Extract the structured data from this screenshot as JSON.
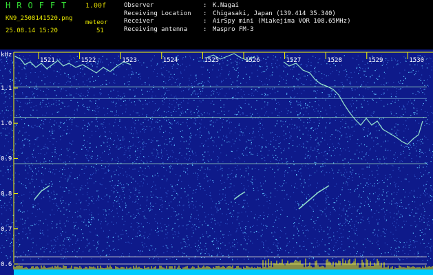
{
  "header": {
    "app_title": "HROFFT",
    "version": "1.00f",
    "file_name": "KN9_2508141520.png",
    "kind": "meteor",
    "datetime": "25.08.14 15:20",
    "count": "51",
    "info": [
      {
        "label": "Observer",
        "value": "K.Nagai"
      },
      {
        "label": "Receiving Location",
        "value": "Chigasaki, Japan (139.414 35.340)"
      },
      {
        "label": "Receiver",
        "value": "AirSpy mini (Miakejima VOR 108.65MHz)"
      },
      {
        "label": "Receiving antenna",
        "value": "Maspro FM-3"
      }
    ]
  },
  "spectrogram": {
    "y_unit": "kHz",
    "y_ticks": [
      "1.1",
      "1.0",
      "0.9",
      "0.8",
      "0.7",
      "0.6"
    ],
    "x_ticks": [
      "1521",
      "1522",
      "1523",
      "1524",
      "1525",
      "1526",
      "1527",
      "1528",
      "1529",
      "1530"
    ],
    "colors": {
      "background": "#0e1a8a",
      "noise": "#5fc8ff",
      "trace": "#9ff0d0",
      "axis": "#ffff00",
      "level": "#00ccff"
    }
  }
}
